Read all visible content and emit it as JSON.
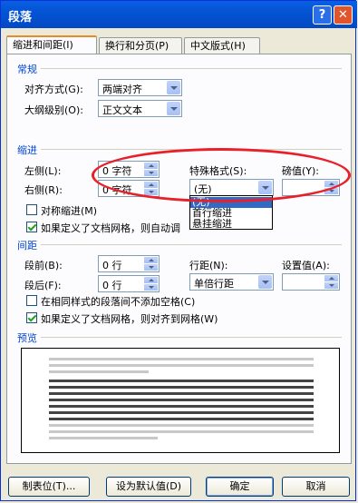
{
  "window": {
    "title": "段落",
    "help_label": "?",
    "close_label": "✕",
    "help_icon": "question-icon",
    "close_icon": "close-icon"
  },
  "tabs": [
    {
      "label": "缩进和间距(I)",
      "active": true
    },
    {
      "label": "换行和分页(P)",
      "active": false
    },
    {
      "label": "中文版式(H)",
      "active": false
    }
  ],
  "general": {
    "heading": "常规",
    "alignment_label": "对齐方式(G):",
    "alignment_value": "两端对齐",
    "outline_label": "大纲级别(O):",
    "outline_value": "正文文本"
  },
  "indent": {
    "heading": "缩进",
    "left_label": "左侧(L):",
    "left_value": "0 字符",
    "right_label": "右侧(R):",
    "right_value": "0 字符",
    "special_label": "特殊格式(S):",
    "special_value": "(无)",
    "by_label": "磅值(Y):",
    "by_value": "",
    "special_options": [
      "(无)",
      "首行缩进",
      "悬挂缩进"
    ],
    "mirror_label": "对称缩进(M)",
    "mirror_checked": false,
    "grid_label": "如果定义了文档网格，则自动调",
    "grid_checked": true
  },
  "spacing": {
    "heading": "间距",
    "before_label": "段前(B):",
    "before_value": "0 行",
    "after_label": "段后(F):",
    "after_value": "0 行",
    "line_label": "行距(N):",
    "line_value": "单倍行距",
    "at_label": "设置值(A):",
    "at_value": "",
    "nospace_label": "在相同样式的段落间不添加空格(C)",
    "nospace_checked": false,
    "snap_label": "如果定义了文档网格，则对齐到网格(W)",
    "snap_checked": true
  },
  "preview": {
    "heading": "预览"
  },
  "buttons": {
    "tabs": "制表位(T)...",
    "default": "设为默认值(D)",
    "ok": "确定",
    "cancel": "取消"
  },
  "colors": {
    "titlebar": "#0454d4",
    "section_heading": "#0046d5",
    "highlight_oval": "#e8202a",
    "selection": "#316ac5"
  }
}
